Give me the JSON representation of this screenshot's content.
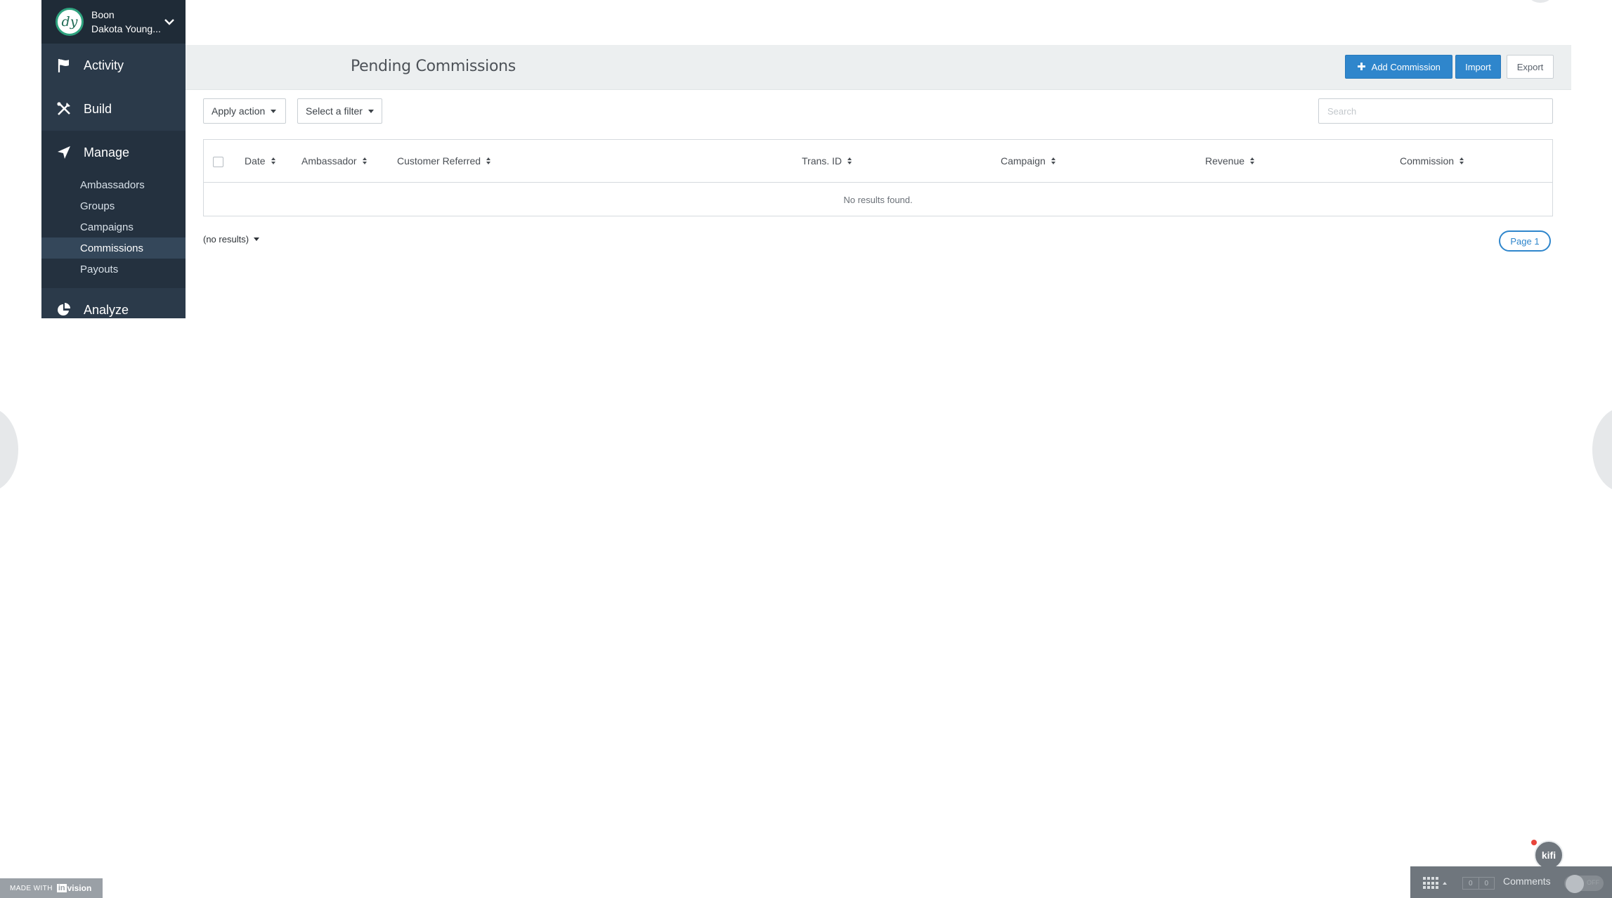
{
  "account": {
    "avatar_initials": "dy",
    "org_name": "Boon",
    "user_name": "Dakota Young..."
  },
  "sidebar": {
    "sections": [
      {
        "label": "Activity",
        "icon": "flag-icon"
      },
      {
        "label": "Build",
        "icon": "tools-icon"
      },
      {
        "label": "Manage",
        "icon": "paper-plane-icon"
      },
      {
        "label": "Analyze",
        "icon": "pie-chart-icon"
      }
    ],
    "manage_items": [
      {
        "label": "Ambassadors",
        "active": false
      },
      {
        "label": "Groups",
        "active": false
      },
      {
        "label": "Campaigns",
        "active": false
      },
      {
        "label": "Commissions",
        "active": true
      },
      {
        "label": "Payouts",
        "active": false
      }
    ]
  },
  "header": {
    "title": "Pending Commissions",
    "add_label": "Add Commission",
    "import_label": "Import",
    "export_label": "Export"
  },
  "toolbar": {
    "apply_action": "Apply action",
    "select_filter": "Select a filter",
    "search_placeholder": "Search"
  },
  "table": {
    "columns": [
      "Date",
      "Ambassador",
      "Customer Referred",
      "Trans. ID",
      "Campaign",
      "Revenue",
      "Commission"
    ],
    "empty_message": "No results found."
  },
  "pagination": {
    "results_label": "(no results)",
    "page_label": "Page 1"
  },
  "invision": {
    "made_with": "MADE WITH",
    "brand_box": "in",
    "brand_rest": "vision"
  },
  "comment_bar": {
    "count_left": "0",
    "count_right": "0",
    "comments_label": "Comments",
    "toggle_state": "OFF"
  },
  "kifi": {
    "label": "kifi"
  },
  "colors": {
    "sidebar_bg": "#2b3a4a",
    "primary": "#2f86cc",
    "header_band": "#eceff0"
  }
}
